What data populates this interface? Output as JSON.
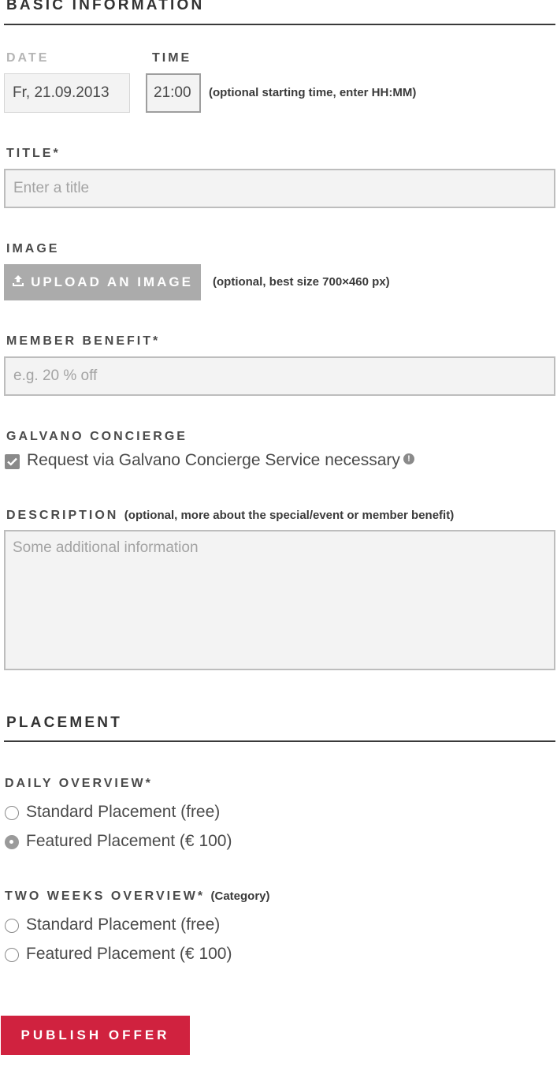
{
  "basic": {
    "heading": "BASIC INFORMATION",
    "date_label": "DATE",
    "date_value": "Fr, 21.09.2013",
    "time_label": "TIME",
    "time_value": "21:00",
    "time_note": "(optional starting time, enter HH:MM)",
    "title_label": "TITLE*",
    "title_placeholder": "Enter a title",
    "image_label": "IMAGE",
    "upload_label": "UPLOAD AN IMAGE",
    "image_note": "(optional, best size 700×460 px)",
    "benefit_label": "MEMBER BENEFIT*",
    "benefit_placeholder": "e.g. 20 % off",
    "concierge_label": "GALVANO CONCIERGE",
    "concierge_option": "Request via Galvano Concierge Service necessary",
    "concierge_checked": true,
    "description_label": "DESCRIPTION",
    "description_note": "(optional, more about the special/event or member benefit)",
    "description_placeholder": "Some additional information"
  },
  "placement": {
    "heading": "PLACEMENT",
    "daily_label": "DAILY OVERVIEW*",
    "daily_options": [
      {
        "label": "Standard Placement (free)",
        "selected": false
      },
      {
        "label": "Featured Placement (€ 100)",
        "selected": true
      }
    ],
    "two_weeks_label": "TWO WEEKS OVERVIEW*",
    "two_weeks_note": "(Category)",
    "two_weeks_options": [
      {
        "label": "Standard Placement (free)",
        "selected": false
      },
      {
        "label": "Featured Placement (€ 100)",
        "selected": false
      }
    ]
  },
  "actions": {
    "publish_label": "PUBLISH OFFER"
  },
  "colors": {
    "accent": "#d0223f",
    "upload_button": "#ababab",
    "field_background": "#f3f3f3"
  }
}
